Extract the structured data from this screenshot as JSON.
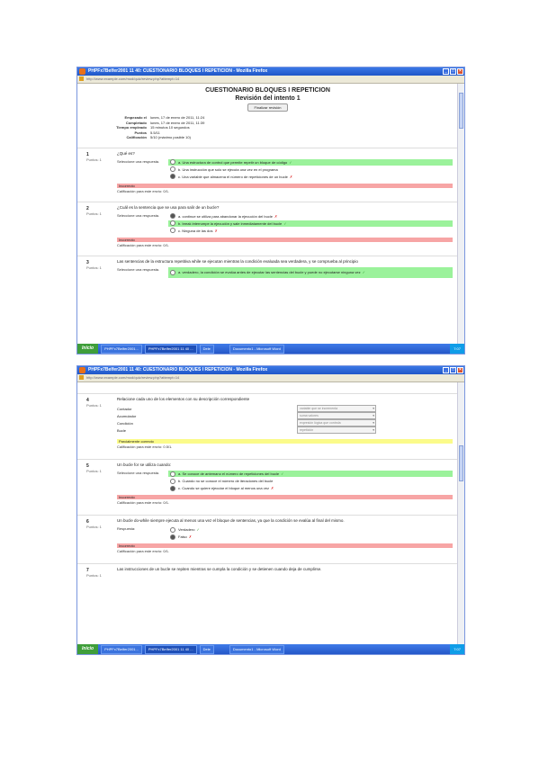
{
  "window": {
    "title": "PHPFx7BeIfer2001 11 40: CUESTIONARIO BLOQUES I REPETICION - Mozilla Firefox",
    "address": "http://www.example.com/mod/quiz/review.php?attempt=14"
  },
  "taskbar": {
    "start": "Inicio",
    "tasks": [
      "PHPFx7BeIfer2001...",
      "PHPFx7BeIfer2001 11 40 ...",
      "Dele"
    ],
    "doc": "Documento1 - Microsoft Word",
    "clock": "7:07"
  },
  "quiz": {
    "title": "CUESTIONARIO BLOQUES I REPETICION",
    "subtitle": "Revisión del intento 1",
    "finish_button": "Finalizar revisión",
    "summary": [
      {
        "k": "Empezado el",
        "v": "lunes, 17 de enero de 2011, 11:24"
      },
      {
        "k": "Completado",
        "v": "lunes, 17 de enero de 2011, 11:39"
      },
      {
        "k": "Tiempo empleado",
        "v": "15 minutos 10 segundos"
      },
      {
        "k": "Puntos",
        "v": "5.5/11"
      },
      {
        "k": "Calificación",
        "v": "5/10 (máximo posible 10)"
      }
    ]
  },
  "screen1": {
    "q1": {
      "no": "1",
      "mark": "Puntos: 1",
      "text": "¿Qué es?",
      "label": "Seleccione una respuesta.",
      "options": [
        {
          "text": "a. Una estructura de control que permite repetir un bloque de código",
          "state": "correct",
          "mark": "✓"
        },
        {
          "text": "b. Una instrucción que solo se ejecuta una vez en el programa",
          "state": "",
          "mark": ""
        },
        {
          "text": "c. Una variable que almacena el número de repeticiones de un bucle",
          "state": "selected",
          "mark": "✗"
        }
      ],
      "feedback": "Incorrecto",
      "graded": "Calificación para este envío: 0/1."
    },
    "q2": {
      "no": "2",
      "mark": "Puntos: 1",
      "text": "¿Cuál es la sentencia que se usa para salir de un bucle?",
      "label": "Seleccione una respuesta.",
      "options": [
        {
          "text": "a. continue se utiliza para abandonar la ejecución del bucle",
          "state": "selected",
          "mark": "✗"
        },
        {
          "text": "b. break interrumpe la ejecución y sale inmediatamente del bucle",
          "state": "correct",
          "mark": "✓"
        },
        {
          "text": "c. Ninguna de las dos",
          "state": "",
          "mark": "✗"
        }
      ],
      "feedback": "Incorrecto",
      "graded": "Calificación para este envío: 0/1."
    },
    "q3": {
      "no": "3",
      "mark": "Puntos: 1",
      "text": "Las sentencias de la estructura repetitiva while se ejecutan mientras la condición evaluada sea verdadera, y se comprueba al principio",
      "label": "Seleccione una respuesta.",
      "options": [
        {
          "text": "a. verdadero, la condición se evalúa antes de ejecutar las sentencias del bucle y puede no ejecutarse ninguna vez",
          "state": "correct",
          "mark": "✓"
        }
      ]
    }
  },
  "screen2": {
    "q4": {
      "no": "4",
      "mark": "Puntos: 1",
      "text": "Relacione cada uno de los elementos con su descripción correspondiente",
      "rows": [
        {
          "label": "Contador",
          "value": "variable que se incrementa"
        },
        {
          "label": "Acumulador",
          "value": "suma valores"
        },
        {
          "label": "Condición",
          "value": "expresión lógica que controla"
        },
        {
          "label": "Bucle",
          "value": "repetición"
        }
      ],
      "feedback": "Parcialmente correcto",
      "graded": "Calificación para este envío: 0.5/1."
    },
    "q5": {
      "no": "5",
      "mark": "Puntos: 1",
      "text": "Un bucle for se utiliza cuando:",
      "label": "Seleccione una respuesta.",
      "options": [
        {
          "text": "a. Se conoce de antemano el número de repeticiones del bucle",
          "state": "correct",
          "mark": "✓"
        },
        {
          "text": "b. Cuando no se conoce el número de iteraciones del bucle",
          "state": "",
          "mark": ""
        },
        {
          "text": "c. Cuando se quiere ejecutar el bloque al menos una vez",
          "state": "selected",
          "mark": "✗"
        }
      ],
      "feedback": "Incorrecto",
      "graded": "Calificación para este envío: 0/1."
    },
    "q6": {
      "no": "6",
      "mark": "Puntos: 1",
      "text": "Un bucle do-while siempre ejecuta al menos una vez el bloque de sentencias, ya que la condición se evalúa al final del mismo.",
      "label": "Respuesta:",
      "options": [
        {
          "text": "Verdadero",
          "state": "",
          "mark": "✓"
        },
        {
          "text": "Falso",
          "state": "selected",
          "mark": "✗"
        }
      ],
      "feedback": "Incorrecto",
      "graded": "Calificación para este envío: 0/1."
    },
    "q7": {
      "no": "7",
      "mark": "Puntos: 1",
      "text": "Las instrucciones de un bucle se repiten mientras se cumpla la condición y se detienen cuando deja de cumplirse."
    }
  }
}
